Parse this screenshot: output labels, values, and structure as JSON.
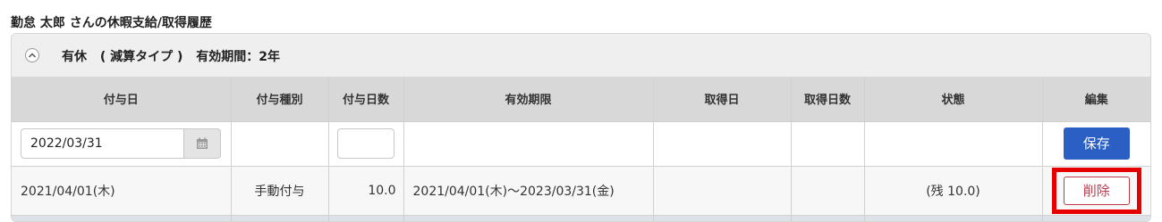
{
  "page": {
    "title": "勤怠 太郎 さんの休暇支給/取得履歴"
  },
  "panel": {
    "leave_type": "有休",
    "calc_type": "( 減算タイプ )",
    "validity": "有効期間：2年",
    "toggle_icon": "chevron-up-icon"
  },
  "table": {
    "headers": [
      "付与日",
      "付与種別",
      "付与日数",
      "有効期限",
      "取得日",
      "取得日数",
      "状態",
      "編集"
    ],
    "input_row": {
      "grant_date_value": "2022/03/31",
      "grant_days_value": "",
      "save_label": "保存"
    },
    "rows": [
      {
        "grant_date": "2021/04/01(木)",
        "grant_type": "手動付与",
        "grant_days": "10.0",
        "expiry": "2021/04/01(木)～2023/03/31(金)",
        "taken_date": "",
        "taken_days": "",
        "status": "(残 10.0)",
        "delete_label": "削除"
      }
    ]
  },
  "colors": {
    "save_button": "#2b5fc4",
    "delete_text": "#c0394b",
    "highlight_frame": "#e60000",
    "header_bg": "#d8d8d8"
  }
}
